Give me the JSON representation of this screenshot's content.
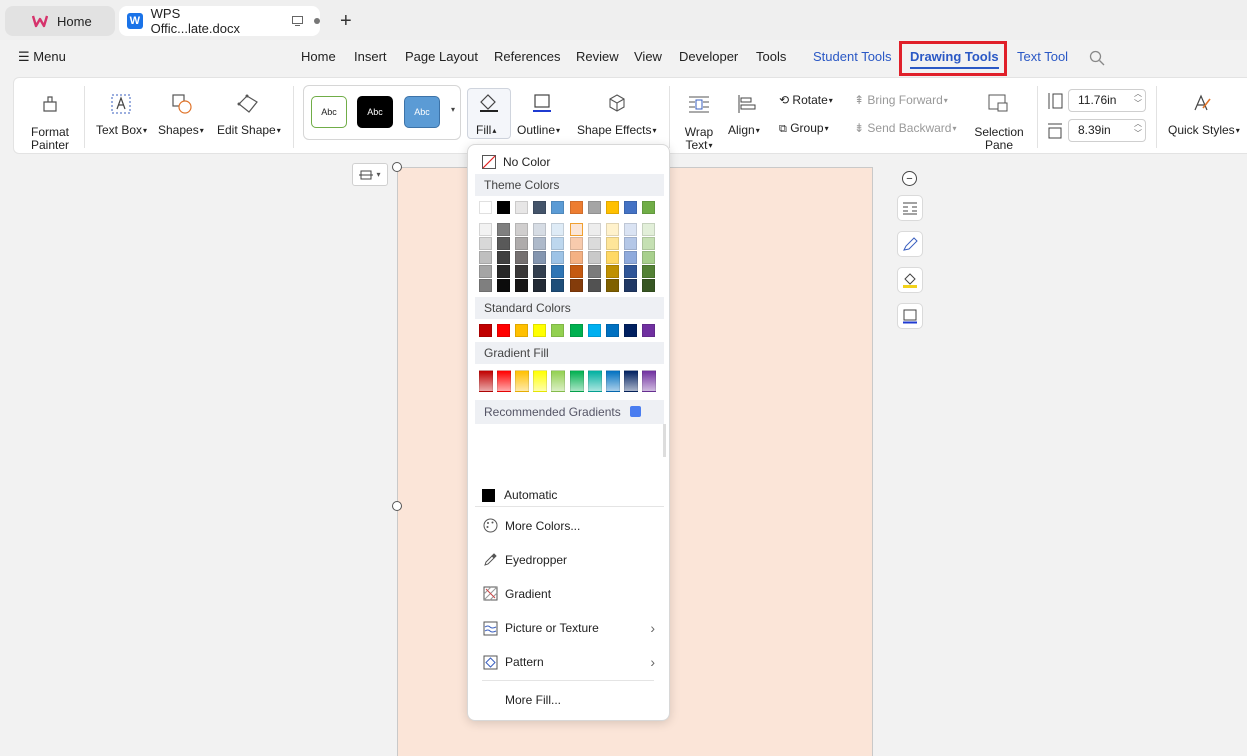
{
  "tabs": {
    "home": "Home",
    "document": "WPS Offic...late.docx",
    "new_tab": "+"
  },
  "menubar": {
    "menu_label": "Menu",
    "items": [
      "Home",
      "Insert",
      "Page Layout",
      "References",
      "Review",
      "View",
      "Developer",
      "Tools"
    ],
    "student_tools": "Student Tools",
    "drawing_tools": "Drawing Tools",
    "text_tool": "Text Tool"
  },
  "ribbon": {
    "format_painter_1": "Format",
    "format_painter_2": "Painter",
    "text_box": "Text Box",
    "shapes": "Shapes",
    "edit_shape": "Edit Shape",
    "style_samples": [
      "Abc",
      "Abc",
      "Abc"
    ],
    "fill": "Fill",
    "outline": "Outline",
    "shape_effects": "Shape Effects",
    "wrap_text_1": "Wrap",
    "wrap_text_2": "Text",
    "align": "Align",
    "rotate": "Rotate",
    "group": "Group",
    "bring_forward": "Bring Forward",
    "send_backward": "Send Backward",
    "selection_pane_1": "Selection",
    "selection_pane_2": "Pane",
    "height_value": "11.76in",
    "width_value": "8.39in",
    "quick_styles": "Quick Styles"
  },
  "fill_menu": {
    "no_color": "No Color",
    "theme_colors": "Theme Colors",
    "theme_top": [
      "#ffffff",
      "#000000",
      "#e7e6e6",
      "#44546a",
      "#5b9bd5",
      "#ed7d31",
      "#a5a5a5",
      "#ffc000",
      "#4472c4",
      "#70ad47"
    ],
    "theme_shades": [
      [
        "#f2f2f2",
        "#7f7f7f",
        "#d0cece",
        "#d6dce4",
        "#deebf6",
        "#fbe5d6",
        "#ededed",
        "#fff2cc",
        "#dae3f3",
        "#e2efd9"
      ],
      [
        "#d8d8d8",
        "#595959",
        "#aeabab",
        "#adb9ca",
        "#bdd7ee",
        "#f8cbad",
        "#dbdbdb",
        "#fee599",
        "#b4c7e7",
        "#c5e0b3"
      ],
      [
        "#bfbfbf",
        "#3f3f3f",
        "#757070",
        "#8496b0",
        "#9dc3e6",
        "#f4b183",
        "#c9c9c9",
        "#ffd966",
        "#8faadc",
        "#a8d08d"
      ],
      [
        "#a5a5a5",
        "#262626",
        "#3a3838",
        "#333f4f",
        "#2e75b5",
        "#c55a11",
        "#7b7b7b",
        "#bf9000",
        "#2f5597",
        "#538135"
      ],
      [
        "#7f7f7f",
        "#0c0c0c",
        "#171616",
        "#222a35",
        "#1e4e79",
        "#843c0b",
        "#525252",
        "#7f6000",
        "#203864",
        "#375623"
      ]
    ],
    "standard_colors": "Standard Colors",
    "standard": [
      "#c00000",
      "#ff0000",
      "#ffc000",
      "#ffff00",
      "#92d050",
      "#00b050",
      "#00b0f0",
      "#0070c0",
      "#002060",
      "#7030a0"
    ],
    "gradient_fill": "Gradient Fill",
    "gradients": [
      "#c00000",
      "#ff0000",
      "#ffc000",
      "#ffff00",
      "#92d050",
      "#00b050",
      "#00b0a0",
      "#0070c0",
      "#002060",
      "#7030a0"
    ],
    "recommended_gradients": "Recommended Gradients",
    "automatic": "Automatic",
    "more_colors": "More Colors...",
    "eyedropper": "Eyedropper",
    "gradient": "Gradient",
    "picture_or_texture": "Picture or Texture",
    "pattern": "Pattern",
    "more_fill": "More Fill..."
  }
}
